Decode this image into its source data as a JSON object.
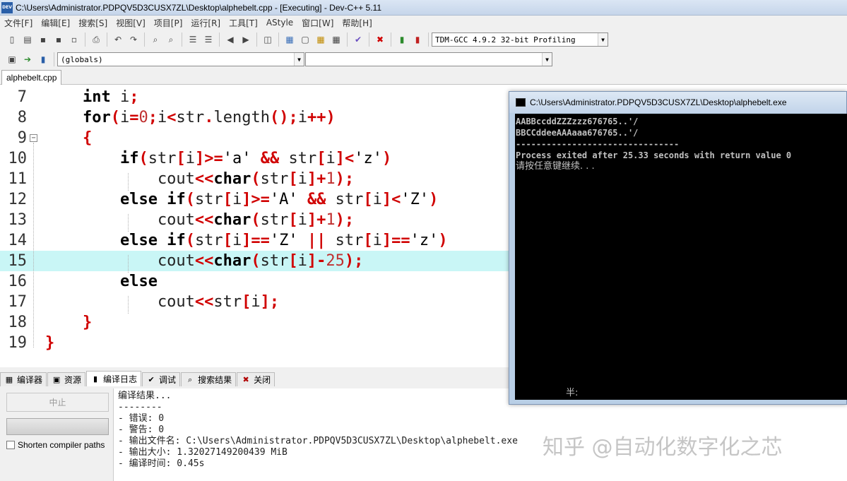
{
  "window": {
    "title": "C:\\Users\\Administrator.PDPQV5D3CUSX7ZL\\Desktop\\alphebelt.cpp - [Executing] - Dev-C++ 5.11",
    "logo_text": "DEV"
  },
  "menu": [
    "文件[F]",
    "编辑[E]",
    "搜索[S]",
    "视图[V]",
    "项目[P]",
    "运行[R]",
    "工具[T]",
    "AStyle",
    "窗口[W]",
    "帮助[H]"
  ],
  "toolbar": {
    "compiler": "TDM-GCC 4.9.2 32-bit Profiling",
    "scope": "(globals)",
    "member": ""
  },
  "editor": {
    "file_tab": "alphebelt.cpp",
    "line_numbers": [
      "7",
      "8",
      "9",
      "10",
      "11",
      "12",
      "13",
      "14",
      "15",
      "16",
      "17",
      "18",
      "19"
    ],
    "highlighted_line": "15",
    "lines": [
      "    int i;",
      "    for(i=0;i<str.length();i++)",
      "    {",
      "        if(str[i]>='a' && str[i]<'z')",
      "            cout<<char(str[i]+1);",
      "        else if(str[i]>='A' && str[i]<'Z')",
      "            cout<<char(str[i]+1);",
      "        else if(str[i]=='Z' || str[i]=='z')",
      "            cout<<char(str[i]-25);",
      "        else",
      "            cout<<str[i];",
      "    }",
      "}"
    ]
  },
  "bottom": {
    "tabs": [
      "编译器",
      "资源",
      "编译日志",
      "调试",
      "搜索结果",
      "关闭"
    ],
    "active_tab": "编译日志",
    "stop_button": "中止",
    "shorten_paths": "Shorten compiler paths",
    "log": [
      "编译结果...",
      "--------",
      "- 错误: 0",
      "- 警告: 0",
      "- 输出文件名: C:\\Users\\Administrator.PDPQV5D3CUSX7ZL\\Desktop\\alphebelt.exe",
      "- 输出大小: 1.32027149200439 MiB",
      "- 编译时间: 0.45s"
    ]
  },
  "console": {
    "title": "C:\\Users\\Administrator.PDPQV5D3CUSX7ZL\\Desktop\\alphebelt.exe",
    "lines": [
      "AABBccddZZZzzz676765..'/",
      "BBCCddeeAAAaaa676765..'/",
      "--------------------------------",
      "Process exited after 25.33 seconds with return value 0",
      "请按任意键继续. . ."
    ],
    "ime_indicator": "半:"
  },
  "watermark": "知乎 @自动化数字化之芯"
}
